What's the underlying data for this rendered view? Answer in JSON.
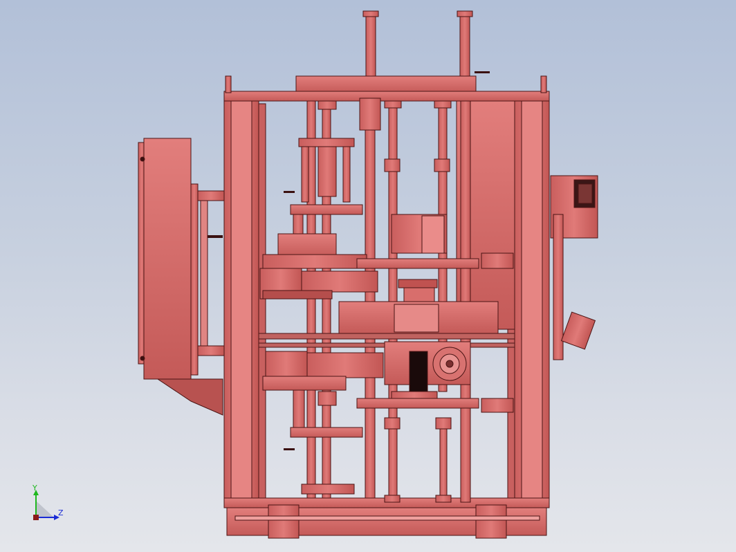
{
  "scene": {
    "model_color": "#d9706f",
    "outline_color": "#4a1414",
    "dark_color": "#1a0a0a",
    "background_top": "#b2c0d8",
    "background_bottom": "#e4e6eb"
  },
  "triad": {
    "y_label": "Y",
    "z_label": "Z",
    "y_color": "#1fb81f",
    "z_color": "#1a2bd6"
  }
}
